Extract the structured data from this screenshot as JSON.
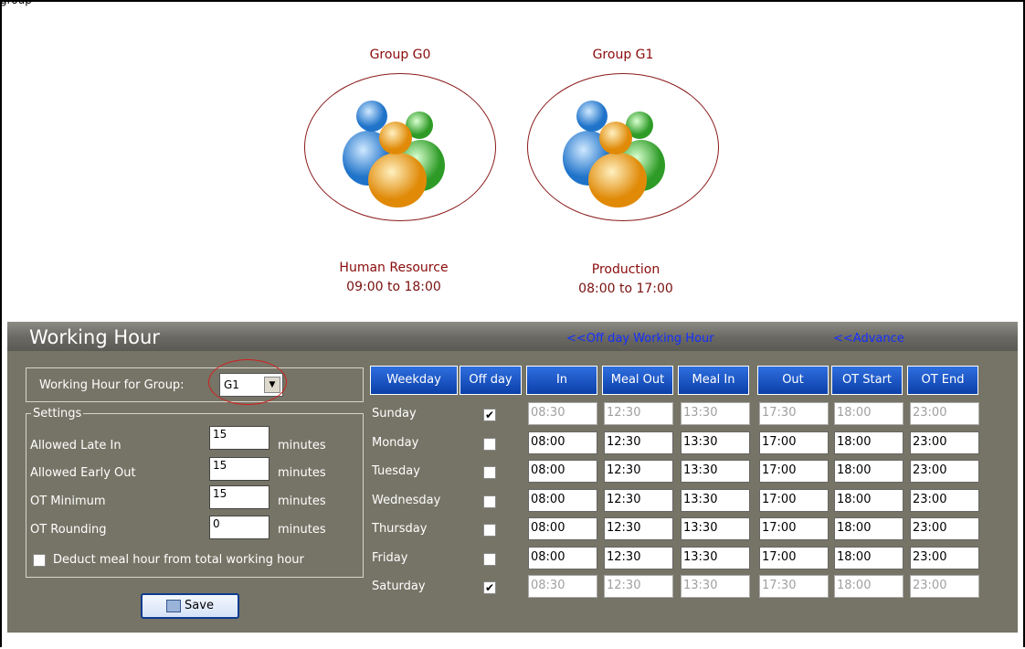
{
  "top_fragment": "group",
  "groups": [
    {
      "title": "Group G0",
      "department": "Human Resource",
      "hours": "09:00 to 18:00"
    },
    {
      "title": "Group G1",
      "department": "Production",
      "hours": "08:00 to 17:00"
    }
  ],
  "panel": {
    "title": "Working Hour",
    "link_offday": "<<Off day Working Hour",
    "link_advance": "<<Advance",
    "group_label": "Working Hour for Group:",
    "group_value": "G1",
    "settings_legend": "Settings",
    "settings": [
      {
        "label": "Allowed Late In",
        "value": "15",
        "unit": "minutes"
      },
      {
        "label": "Allowed Early Out",
        "value": "15",
        "unit": "minutes"
      },
      {
        "label": "OT Minimum",
        "value": "15",
        "unit": "minutes"
      },
      {
        "label": "OT Rounding",
        "value": "0",
        "unit": "minutes"
      }
    ],
    "deduct_label": "Deduct meal hour from total working hour",
    "save_label": "Save",
    "headers": [
      "Weekday",
      "Off day",
      "In",
      "Meal Out",
      "Meal In",
      "Out",
      "OT Start",
      "OT End"
    ],
    "days": [
      {
        "name": "Sunday",
        "off": true,
        "times": [
          "08:30",
          "12:30",
          "13:30",
          "17:30",
          "18:00",
          "23:00"
        ]
      },
      {
        "name": "Monday",
        "off": false,
        "times": [
          "08:00",
          "12:30",
          "13:30",
          "17:00",
          "18:00",
          "23:00"
        ]
      },
      {
        "name": "Tuesday",
        "off": false,
        "times": [
          "08:00",
          "12:30",
          "13:30",
          "17:00",
          "18:00",
          "23:00"
        ]
      },
      {
        "name": "Wednesday",
        "off": false,
        "times": [
          "08:00",
          "12:30",
          "13:30",
          "17:00",
          "18:00",
          "23:00"
        ]
      },
      {
        "name": "Thursday",
        "off": false,
        "times": [
          "08:00",
          "12:30",
          "13:30",
          "17:00",
          "18:00",
          "23:00"
        ]
      },
      {
        "name": "Friday",
        "off": false,
        "times": [
          "08:00",
          "12:30",
          "13:30",
          "17:00",
          "18:00",
          "23:00"
        ]
      },
      {
        "name": "Saturday",
        "off": true,
        "times": [
          "08:30",
          "12:30",
          "13:30",
          "17:30",
          "18:00",
          "23:00"
        ]
      }
    ]
  },
  "colors": {
    "group_text": "#8a0b0b",
    "panel_bg": "#767466",
    "header_blue": "#1a4fc4",
    "link_blue": "#1530ff"
  }
}
